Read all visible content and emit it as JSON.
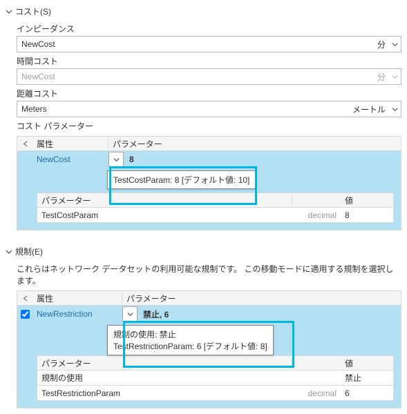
{
  "cost_section": {
    "title": "コスト(S)",
    "impedance_label": "インピーダンス",
    "impedance_value": "NewCost",
    "impedance_unit": "分",
    "time_label": "時間コスト",
    "time_value": "NewCost",
    "time_unit": "分",
    "distance_label": "距離コスト",
    "distance_value": "Meters",
    "distance_unit": "メートル",
    "grid_title": "コスト パラメーター",
    "hdr_attr": "属性",
    "hdr_param": "パラメーター",
    "row_attr": "NewCost",
    "row_param": "8",
    "tooltip": "TestCostParam: 8 [デフォルト値: 10]",
    "inner_hdr_param": "パラメーター",
    "inner_hdr_val": "値",
    "inner_row_param": "TestCostParam",
    "inner_row_type": "decimal",
    "inner_row_val": "8"
  },
  "restr_section": {
    "title": "規制(E)",
    "desc": "これらはネットワーク データセットの利用可能な規制です。 この移動モードに適用する規制を選択します。",
    "hdr_attr": "属性",
    "hdr_param": "パラメーター",
    "row_attr": "NewRestriction",
    "row_param": "禁止, 6",
    "tooltip_line1": "規制の使用: 禁止",
    "tooltip_line2": "TestRestrictionParam: 6 [デフォルト値: 8]",
    "inner_hdr_param": "パラメーター",
    "inner_hdr_val": "値",
    "r1_param": "規制の使用",
    "r1_val": "禁止",
    "r2_param": "TestRestrictionParam",
    "r2_type": "decimal",
    "r2_val": "6"
  }
}
